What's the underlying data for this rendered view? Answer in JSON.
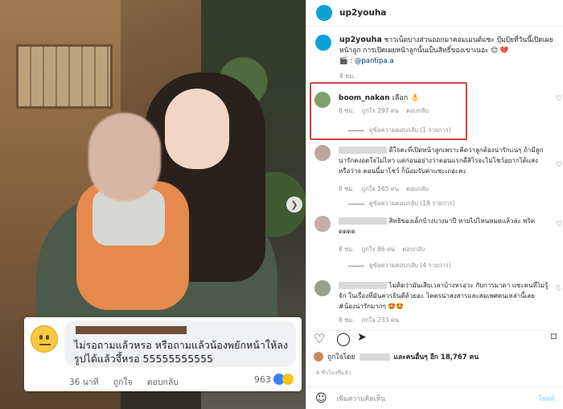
{
  "post": {
    "username": "up2youha",
    "caption_username": "up2youha",
    "caption_text": "ชาวเน็ตบางส่วนออกมาคอมเมนต์แซะ ปุ้มปุ้ยที่วันนี้เปิดเผยหน้าลูก การเปิดเผยหน้าลูกนั้นเป็นสิทธิ์ของเขาเนอะ 😊 💔",
    "caption_source": "🎬 : @pantipa.a",
    "caption_time": "8 ชม.",
    "likes_text": "ถูกใจโดย",
    "likes_others": "และคนอื่นๆ อีก 18,767 คน",
    "time_ago": "8 ชั่วโมงที่แล้ว",
    "add_comment_placeholder": "เพิ่มความคิดเห็น",
    "post_button": "โพสต์"
  },
  "comments": [
    {
      "name": "boom_nakan",
      "text": "เลือก 👌",
      "time": "8 ชม.",
      "likes": "ถูกใจ 297 คน",
      "reply": "ตอบกลับ",
      "replies": "ดูข้อความตอบกลับ (1 รายการ)"
    },
    {
      "text": "ดีใจคะที่เปิดหน้าลูกเพราะคิดว่าลูกต้องน่ารักแน่ๆ ถ้ามีลูกน่ารักคงอดใจไม่ไหว แต่ก่อนอย่างว่าตอนแรกดีสิโรจะไม่โชว์อยากได้แสงหรือว่าจ ตอนนี้มาโชว์ ก็น้อมรับค่าแซะเถอะคะ",
      "time": "8 ชม.",
      "likes": "ถูกใจ 165 คน",
      "reply": "ตอบกลับ",
      "replies": "ดูข้อความตอบกลับ (18 รายการ)"
    },
    {
      "text": "สิทธิของเด็กบ้างบางมาปี หายไปไหนหมดแล้วล่ะ พริค ดดดด",
      "time": "8 ชม.",
      "likes": "ถูกใจ 86 คน",
      "reply": "ตอบกลับ",
      "replies": "ดูข้อความตอบกลับ (4 รายการ)"
    },
    {
      "text": "ไม่คิดว่ามันเสียเวลาบ้างหรอวะ กับการมาดา แซะคนที่ไม่รู้จัก ในเรื่องที่มันควรยินดีด้วยอะ โคตรน่าสงสารและสมเพศคนเหล่านี้เลย #น้องน่ารักมากๆ 🤩🤩",
      "time": "8 ชม.",
      "likes": "ถูกใจ 233 คน"
    }
  ],
  "overlay": {
    "text": "ไม่รอถามแล้วหรอ หรือถามแล้วน้องพยักหน้าให้ลงรูปได้แล้วจึ้หรอ 55555555555",
    "time": "36 นาที",
    "like": "ถูกใจ",
    "reply": "ตอบกลับ",
    "reactions": "963"
  },
  "colors": {
    "accent_red": "#d84040",
    "avatar_blue": "#0aa2d8",
    "link_blue": "#00376b"
  }
}
